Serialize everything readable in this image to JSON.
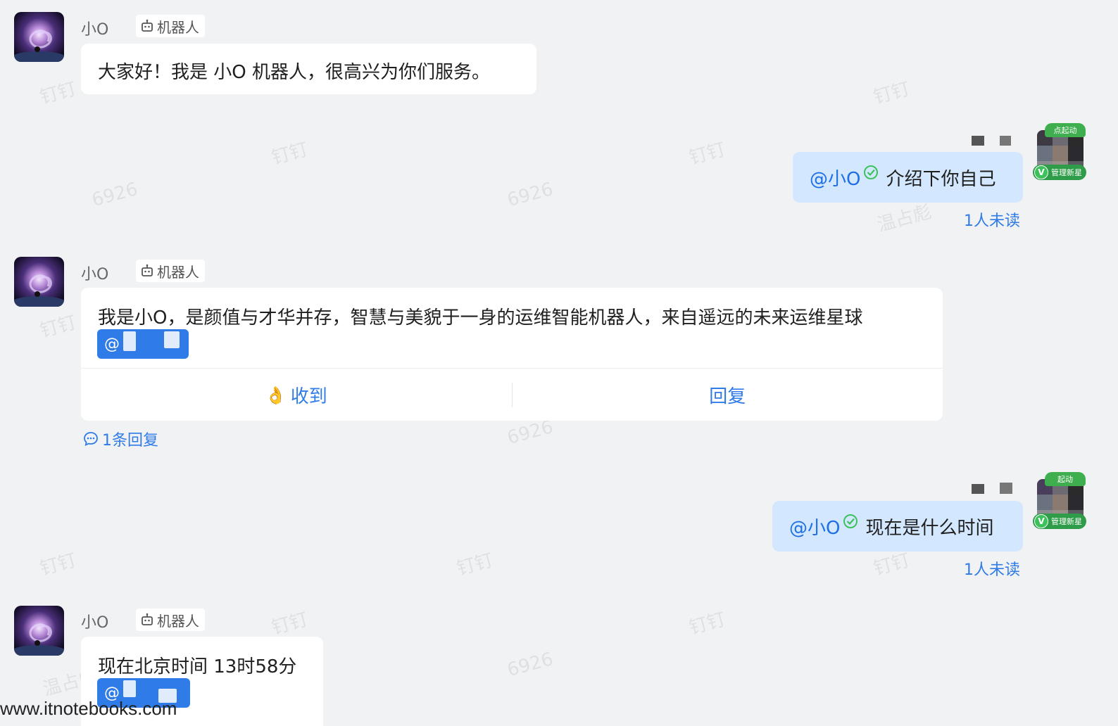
{
  "watermark": {
    "texts": [
      "钉钉",
      "温占彪",
      "6926"
    ]
  },
  "messages": [
    {
      "sender": "小O",
      "robot_tag": "机器人",
      "text": "大家好！我是 小O 机器人，很高兴为你们服务。"
    },
    {
      "mention": "@小O",
      "text": "介绍下你自己",
      "unread": "1人未读",
      "badge": "管理新星",
      "crown": "点起动"
    },
    {
      "sender": "小O",
      "robot_tag": "机器人",
      "text": "我是小O，是颜值与才华并存，智慧与美貌于一身的运维智能机器人，来自遥远的未来运维星球",
      "at_chip": "@",
      "actions": {
        "received": "收到",
        "reply": "回复"
      },
      "reply_count": "1条回复"
    },
    {
      "mention": "@小O",
      "text": "现在是什么时间",
      "unread": "1人未读",
      "badge": "管理新星",
      "crown": "起动"
    },
    {
      "sender": "小O",
      "robot_tag": "机器人",
      "text": "现在北京时间 13时58分",
      "at_chip": "@"
    }
  ],
  "footer": {
    "site": "www.itnotebooks.com"
  },
  "colors": {
    "background": "#f1f2f4",
    "my_bubble": "#d3e8ff",
    "accent_blue": "#2f7be8",
    "verified_green": "#3cc15b"
  }
}
